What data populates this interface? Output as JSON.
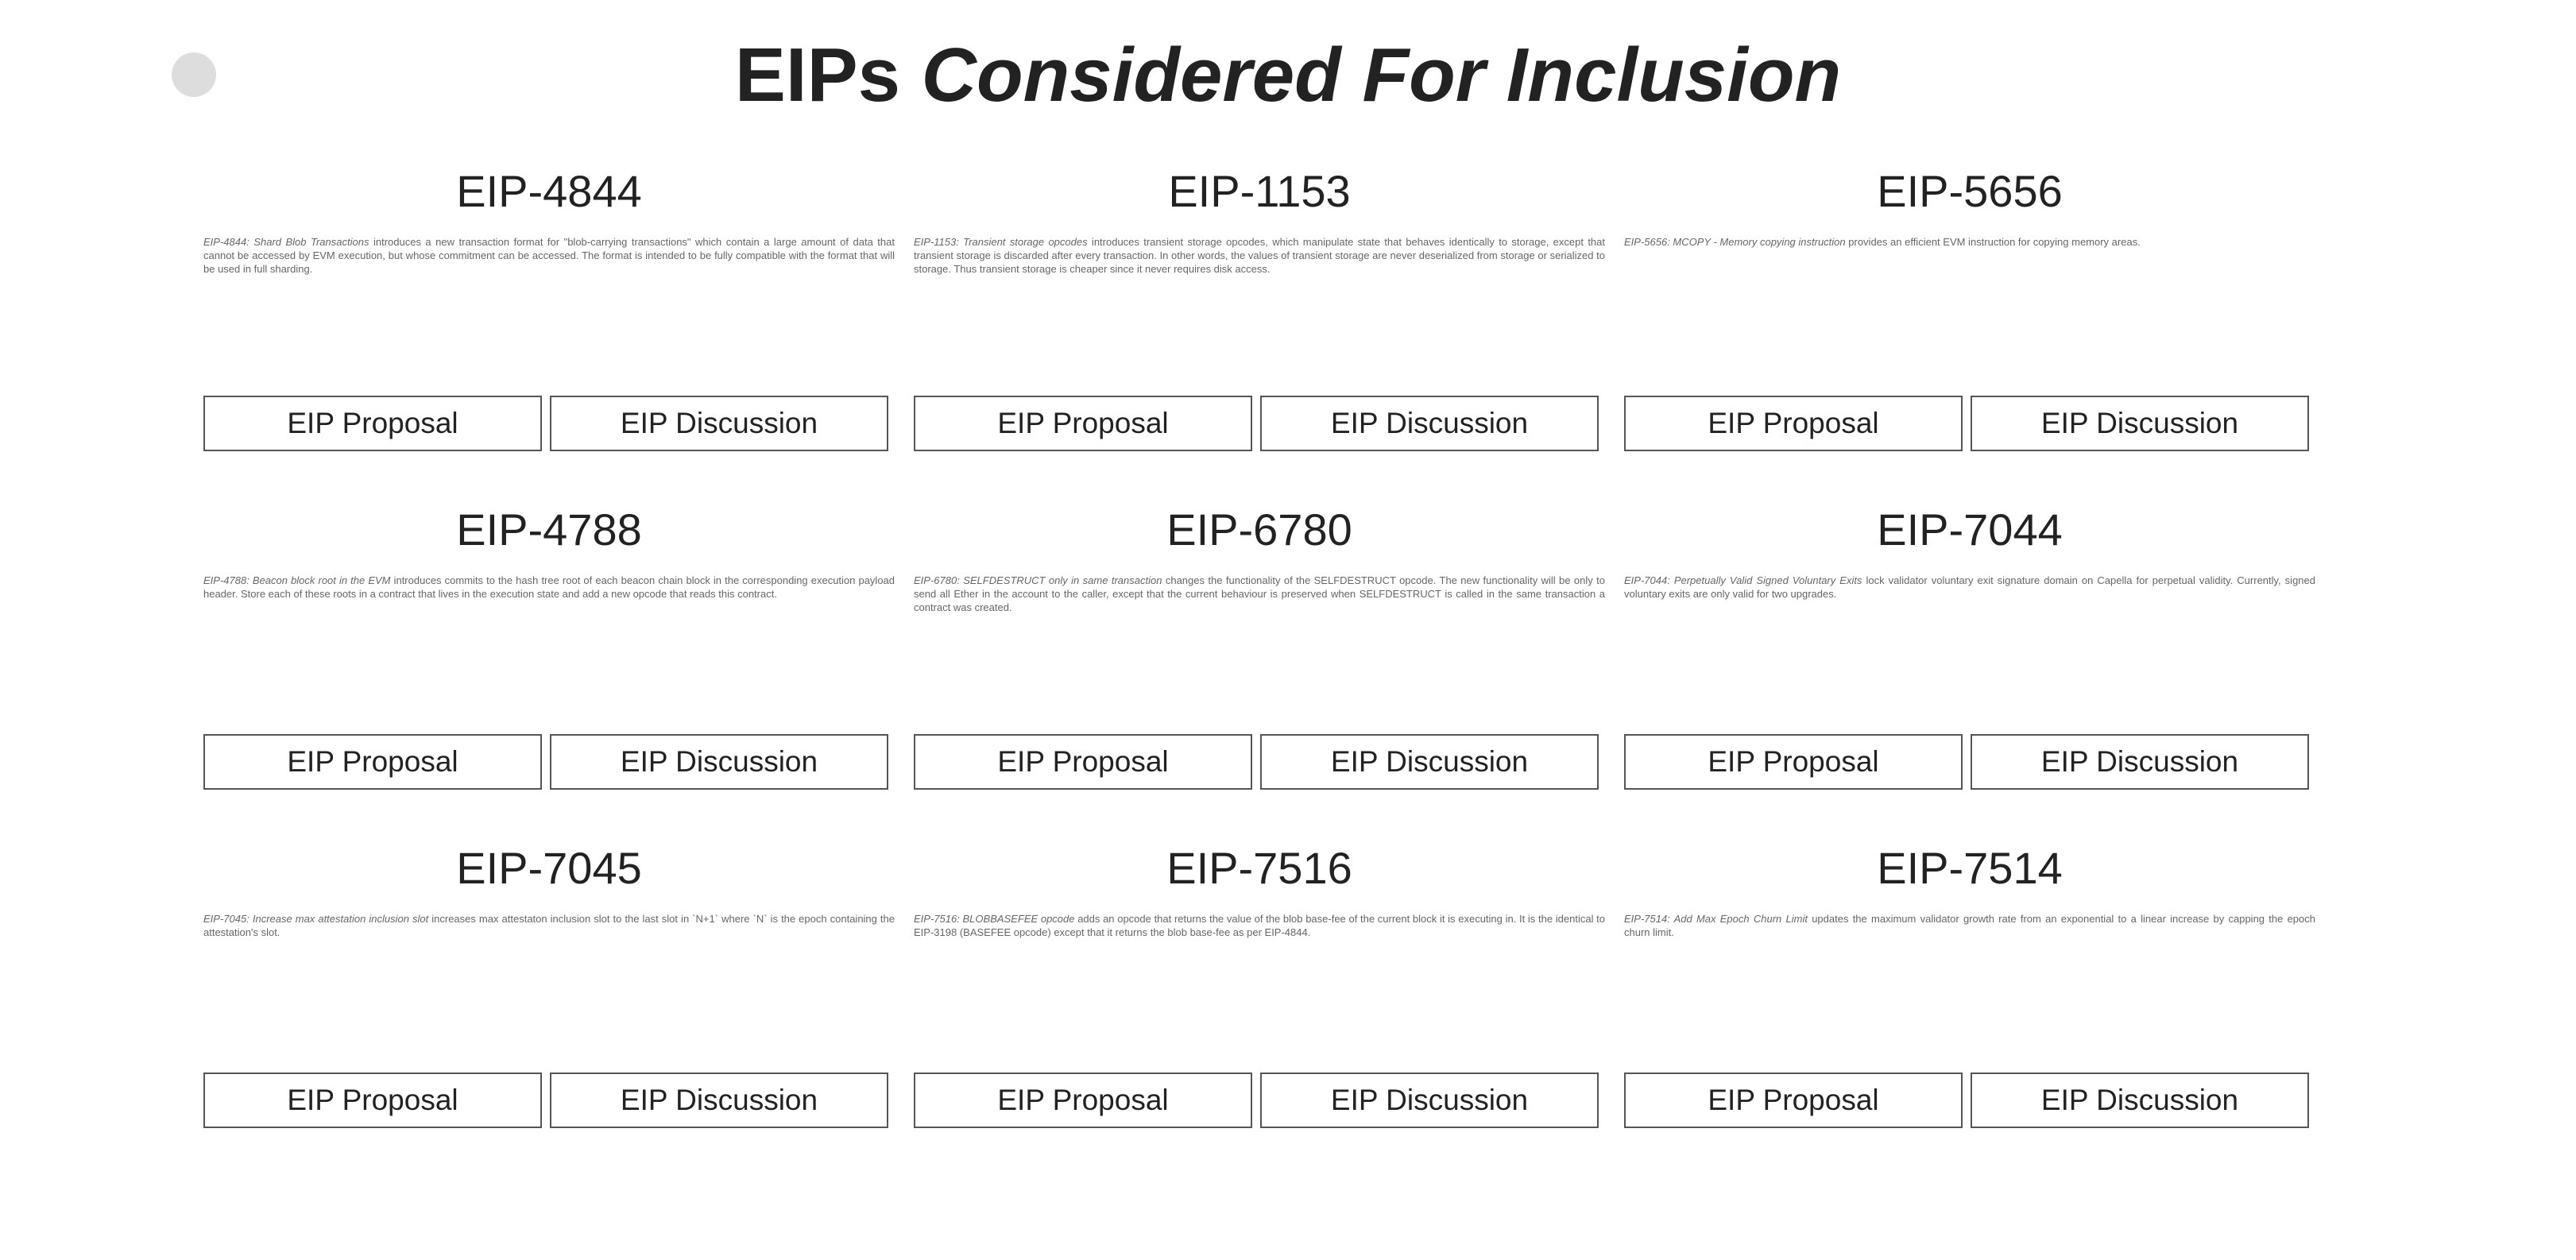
{
  "header": {
    "title_plain": "EIPs",
    "title_emphasis": "Considered For Inclusion"
  },
  "cards": [
    {
      "title": "EIP-4844",
      "desc_emphasis": "EIP-4844: Shard Blob Transactions",
      "desc_text": " introduces a new transaction format for \"blob-carrying transactions\" which contain a large amount of data that cannot be accessed by EVM execution, but whose commitment can be accessed. The format is intended to be fully compatible with the format that will be used in full sharding.",
      "proposal_label": "EIP Proposal",
      "discussion_label": "EIP Discussion"
    },
    {
      "title": "EIP-1153",
      "desc_emphasis": "EIP-1153: Transient storage opcodes",
      "desc_text": " introduces transient storage opcodes, which manipulate state that behaves identically to storage, except that transient storage is discarded after every transaction. In other words, the values of transient storage are never deserialized from storage or serialized to storage. Thus transient storage is cheaper since it never requires disk access.",
      "proposal_label": "EIP Proposal",
      "discussion_label": "EIP Discussion"
    },
    {
      "title": "EIP-5656",
      "desc_emphasis": "EIP-5656: MCOPY - Memory copying instruction",
      "desc_text": " provides an efficient EVM instruction for copying memory areas.",
      "proposal_label": "EIP Proposal",
      "discussion_label": "EIP Discussion"
    },
    {
      "title": "EIP-4788",
      "desc_emphasis": "EIP-4788: Beacon block root in the EVM",
      "desc_text": " introduces commits to the hash tree root of each beacon chain block in the corresponding execution payload header. Store each of these roots in a contract that lives in the execution state and add a new opcode that reads this contract.",
      "proposal_label": "EIP Proposal",
      "discussion_label": "EIP Discussion"
    },
    {
      "title": "EIP-6780",
      "desc_emphasis": "EIP-6780: SELFDESTRUCT only in same transaction",
      "desc_text": " changes the functionality of the SELFDESTRUCT opcode. The new functionality will be only to send all Ether in the account to the caller, except that the current behaviour is preserved when SELFDESTRUCT is called in the same transaction a contract was created.",
      "proposal_label": "EIP Proposal",
      "discussion_label": "EIP Discussion"
    },
    {
      "title": "EIP-7044",
      "desc_emphasis": "EIP-7044: Perpetually Valid Signed Voluntary Exits",
      "desc_text": " lock validator voluntary exit signature domain on Capella for perpetual validity. Currently, signed voluntary exits are only valid for two upgrades.",
      "proposal_label": "EIP Proposal",
      "discussion_label": "EIP Discussion"
    },
    {
      "title": "EIP-7045",
      "desc_emphasis": "EIP-7045: Increase max attestation inclusion slot",
      "desc_text": " increases max attestaton inclusion slot to the last slot in `N+1` where `N` is the epoch containing the attestation's slot.",
      "proposal_label": "EIP Proposal",
      "discussion_label": "EIP Discussion"
    },
    {
      "title": "EIP-7516",
      "desc_emphasis": "EIP-7516: BLOBBASEFEE opcode",
      "desc_text": " adds an opcode that returns the value of the blob base-fee of the current block it is executing in. It is the identical to EIP-3198 (BASEFEE opcode) except that it returns the blob base-fee as per EIP-4844.",
      "proposal_label": "EIP Proposal",
      "discussion_label": "EIP Discussion"
    },
    {
      "title": "EIP-7514",
      "desc_emphasis": "EIP-7514: Add Max Epoch Churn Limit",
      "desc_text": " updates the maximum validator growth rate from an exponential to a linear increase by capping the epoch churn limit.",
      "proposal_label": "EIP Proposal",
      "discussion_label": "EIP Discussion"
    }
  ]
}
